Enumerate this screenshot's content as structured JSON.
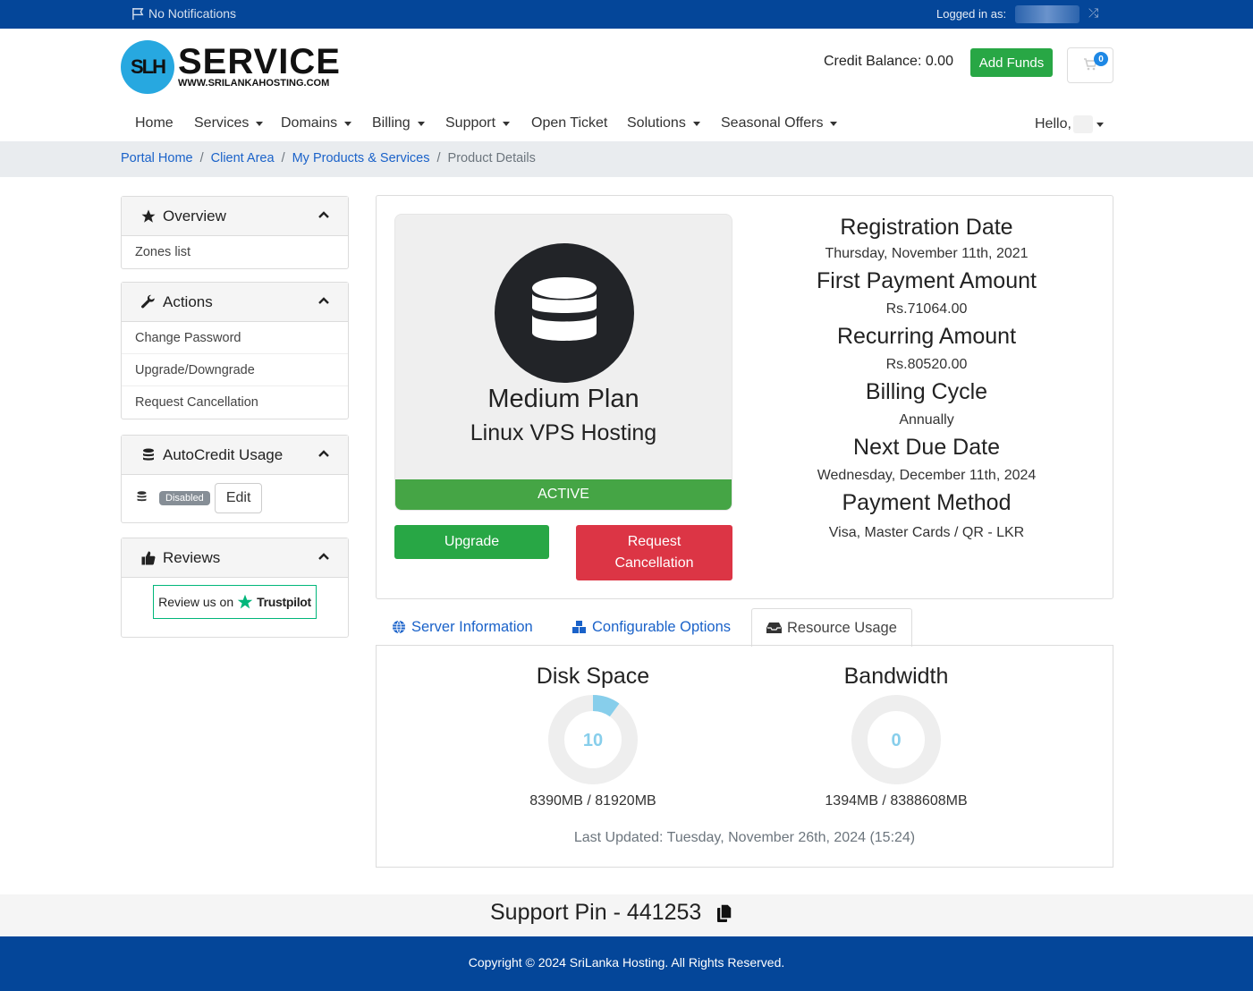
{
  "topbar": {
    "notifications": "No Notifications",
    "logged_in_label": "Logged in as:"
  },
  "brand": {
    "logo_initials": "SLH",
    "logo_title": "SERVICE",
    "logo_url_text": "WWW.SRILANKAHOSTING.COM",
    "primary_color": "#044699"
  },
  "header": {
    "credit_balance": "Credit Balance: 0.00",
    "add_funds": "Add Funds",
    "cart_count": "0"
  },
  "nav": {
    "items": [
      {
        "label": "Home",
        "dropdown": false
      },
      {
        "label": "Services",
        "dropdown": true
      },
      {
        "label": "Domains",
        "dropdown": true
      },
      {
        "label": "Billing",
        "dropdown": true
      },
      {
        "label": "Support",
        "dropdown": true
      },
      {
        "label": "Open Ticket",
        "dropdown": false
      },
      {
        "label": "Solutions",
        "dropdown": true
      },
      {
        "label": "Seasonal Offers",
        "dropdown": true
      }
    ],
    "hello": "Hello,"
  },
  "breadcrumb": {
    "items": [
      "Portal Home",
      "Client Area",
      "My Products & Services"
    ],
    "current": "Product Details",
    "separator": "/"
  },
  "sidebar": {
    "overview": {
      "title": "Overview",
      "items": [
        "Zones list"
      ]
    },
    "actions": {
      "title": "Actions",
      "items": [
        "Change Password",
        "Upgrade/Downgrade",
        "Request Cancellation"
      ]
    },
    "autocredit": {
      "title": "AutoCredit Usage",
      "status_badge": "Disabled",
      "edit_label": "Edit"
    },
    "reviews": {
      "title": "Reviews",
      "trustpilot_prefix": "Review us on",
      "trustpilot_brand": "Trustpilot"
    }
  },
  "product": {
    "plan_name": "Medium Plan",
    "product_type": "Linux VPS Hosting",
    "status": "ACTIVE",
    "upgrade_label": "Upgrade",
    "cancel_label": "Request Cancellation"
  },
  "details": [
    {
      "label": "Registration Date",
      "value": "Thursday, November 11th, 2021"
    },
    {
      "label": "First Payment Amount",
      "value": "Rs.71064.00"
    },
    {
      "label": "Recurring Amount",
      "value": "Rs.80520.00"
    },
    {
      "label": "Billing Cycle",
      "value": "Annually"
    },
    {
      "label": "Next Due Date",
      "value": "Wednesday, December 11th, 2024"
    },
    {
      "label": "Payment Method",
      "value": "Visa, Master Cards / QR - LKR"
    }
  ],
  "tabs": [
    {
      "label": "Server Information",
      "icon": "globe-icon",
      "active": false
    },
    {
      "label": "Configurable Options",
      "icon": "cubes-icon",
      "active": false
    },
    {
      "label": "Resource Usage",
      "icon": "inbox-icon",
      "active": true
    }
  ],
  "resource_usage": {
    "disk": {
      "title": "Disk Space",
      "percent": 10,
      "percent_label": "10",
      "usage": "8390MB / 81920MB"
    },
    "bandwidth": {
      "title": "Bandwidth",
      "percent": 0,
      "percent_label": "0",
      "usage": "1394MB / 8388608MB"
    },
    "last_updated": "Last Updated: Tuesday, November 26th, 2024 (15:24)",
    "gauge_color": "#87ceeb",
    "track_color": "#eeeeee"
  },
  "support_pin": "Support Pin - 441253",
  "footer": {
    "copyright": "Copyright © 2024 SriLanka Hosting. All Rights Reserved."
  }
}
